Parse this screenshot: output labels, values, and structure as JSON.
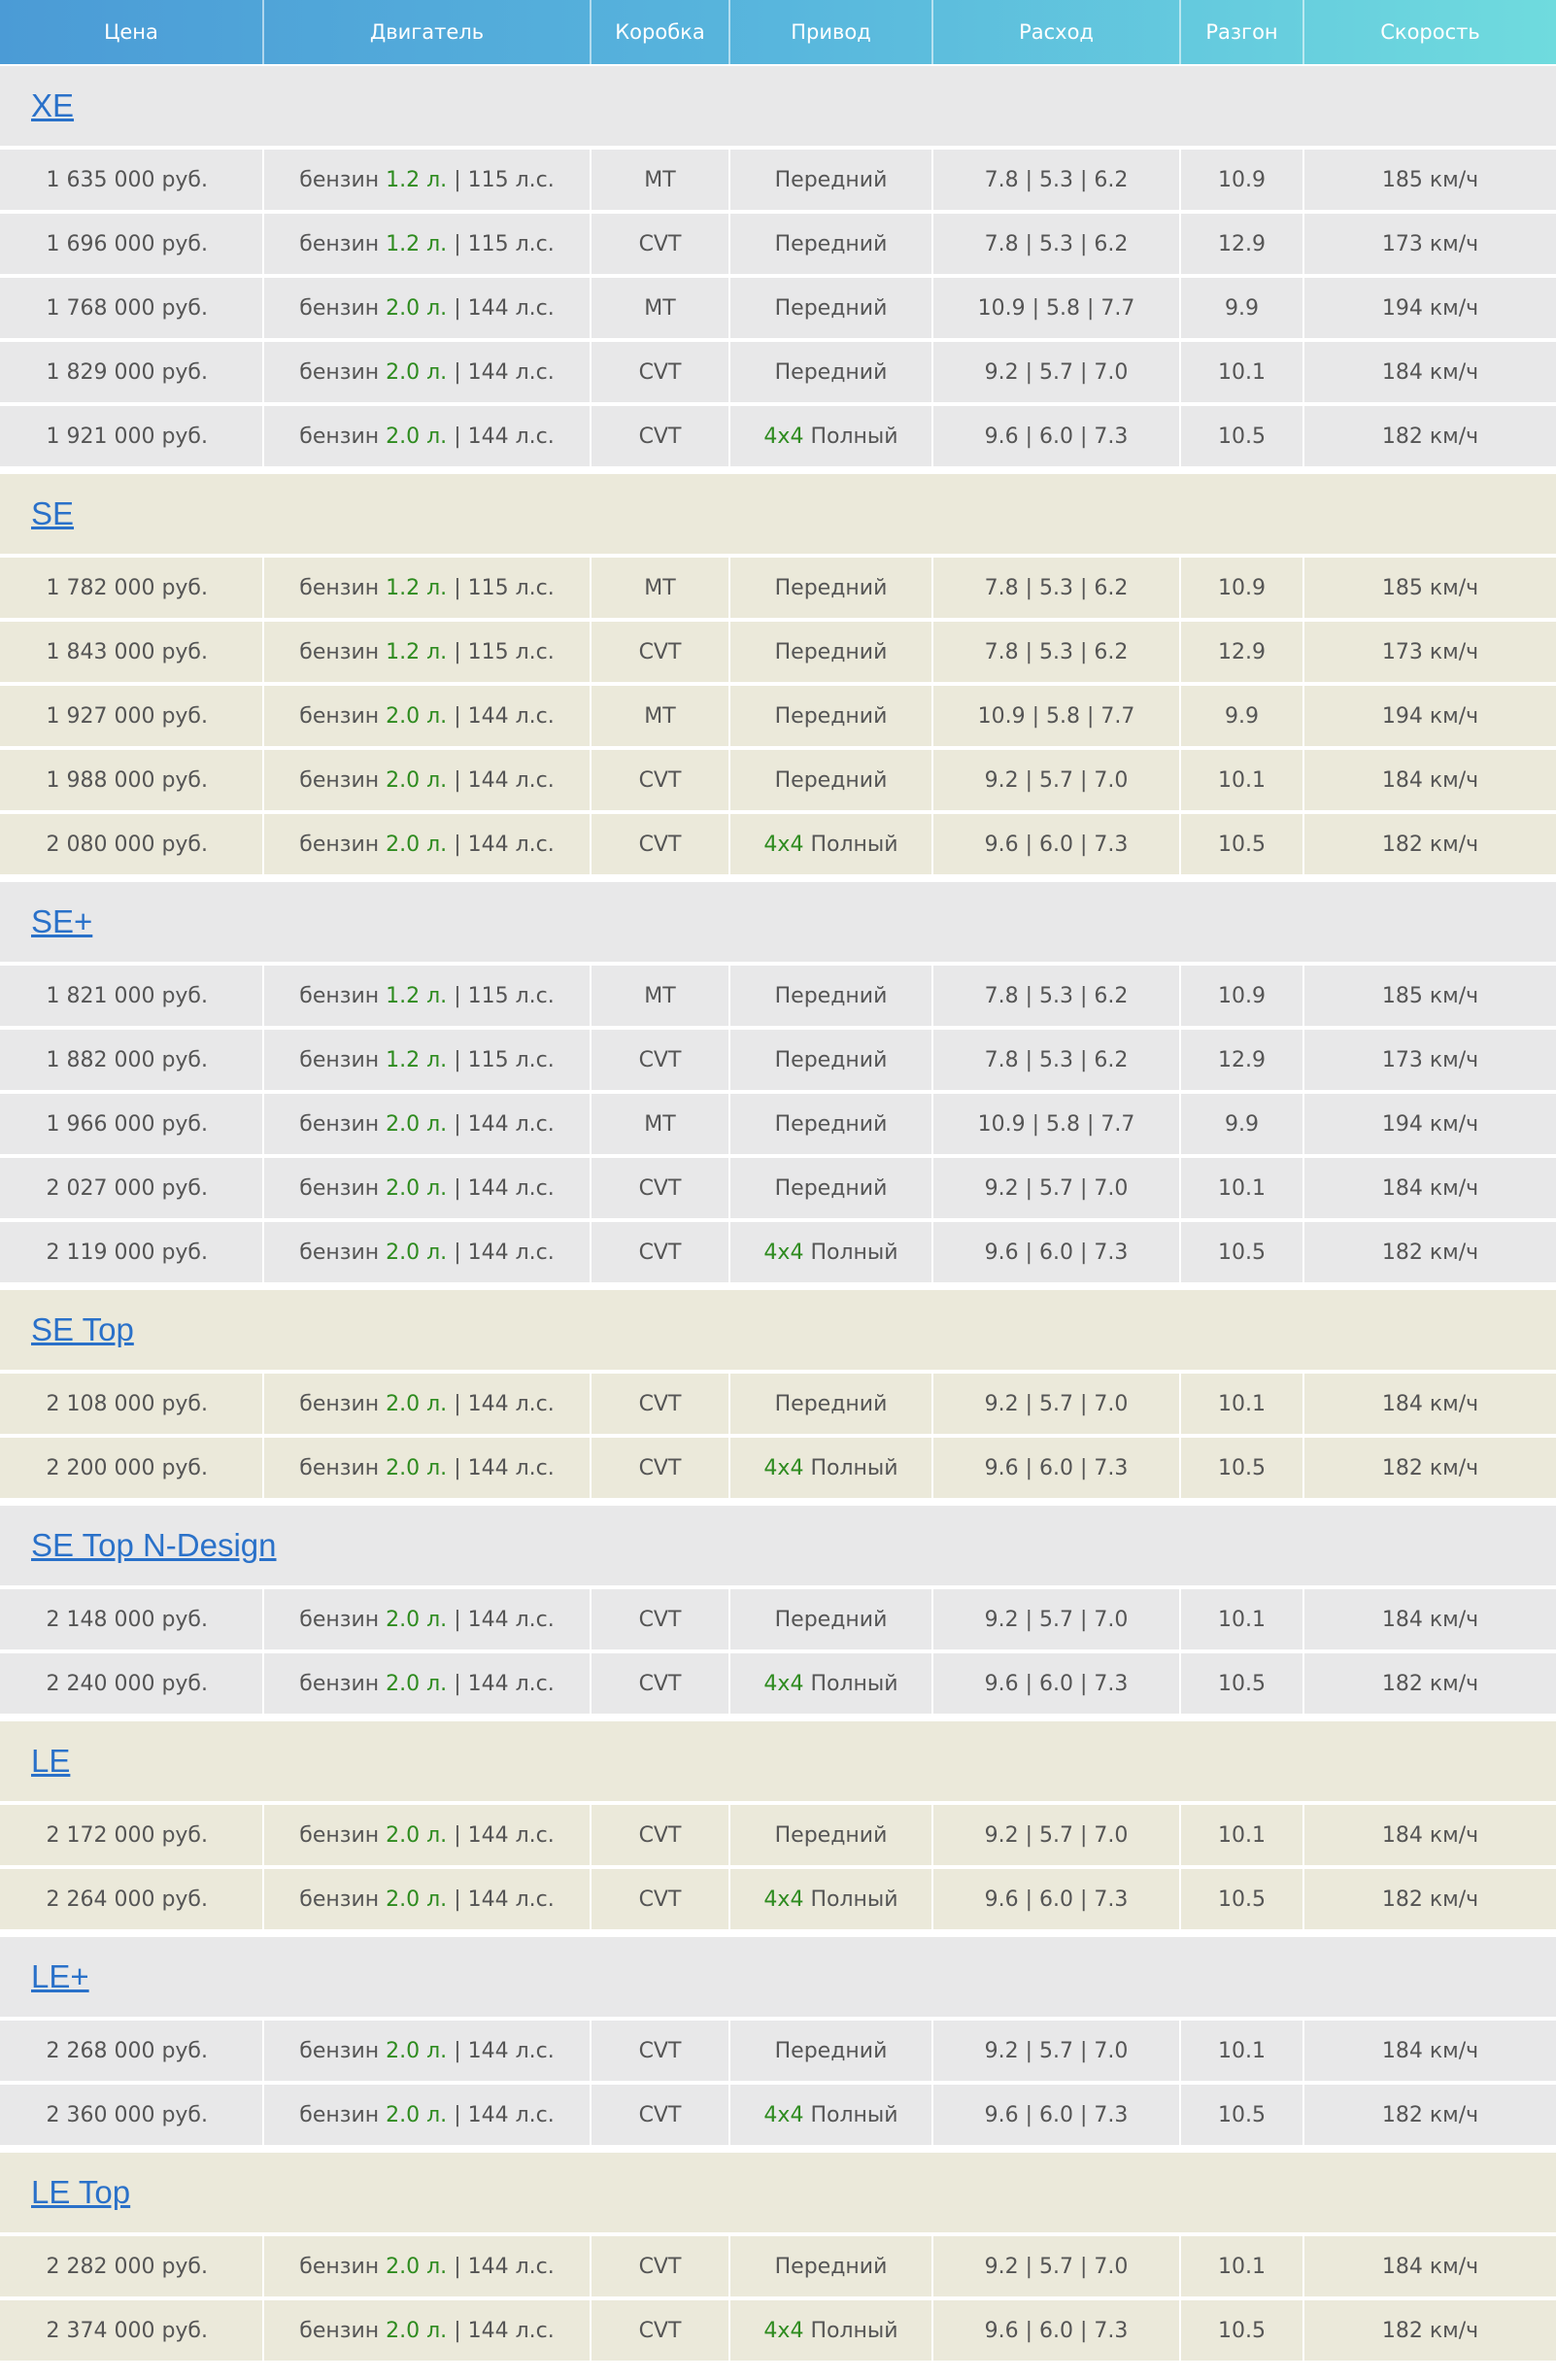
{
  "colors": {
    "header_gradient_start": "#4b9bd6",
    "header_gradient_end": "#6fdbde",
    "header_text": "#ffffff",
    "link": "#2a71c9",
    "green_accent": "#2e8b1f",
    "row_gray": "#e8e8e9",
    "row_beige": "#ebe9da",
    "cell_text": "#555555"
  },
  "header": {
    "price": "Цена",
    "engine": "Двигатель",
    "gearbox": "Коробка",
    "drive": "Привод",
    "consumption": "Расход",
    "acceleration": "Разгон",
    "speed": "Скорость"
  },
  "groups": [
    {
      "name": "XE",
      "rows": [
        {
          "price": "1 635 000 руб.",
          "fuel": "бензин",
          "volume": "1.2 л.",
          "power": "| 115 л.с.",
          "gearbox": "MT",
          "drive_tag": "",
          "drive": "Передний",
          "consumption": "7.8 | 5.3 | 6.2",
          "acceleration": "10.9",
          "speed": "185 км/ч"
        },
        {
          "price": "1 696 000 руб.",
          "fuel": "бензин",
          "volume": "1.2 л.",
          "power": "| 115 л.с.",
          "gearbox": "CVT",
          "drive_tag": "",
          "drive": "Передний",
          "consumption": "7.8 | 5.3 | 6.2",
          "acceleration": "12.9",
          "speed": "173 км/ч"
        },
        {
          "price": "1 768 000 руб.",
          "fuel": "бензин",
          "volume": "2.0 л.",
          "power": "| 144 л.с.",
          "gearbox": "MT",
          "drive_tag": "",
          "drive": "Передний",
          "consumption": "10.9 | 5.8 | 7.7",
          "acceleration": "9.9",
          "speed": "194 км/ч"
        },
        {
          "price": "1 829 000 руб.",
          "fuel": "бензин",
          "volume": "2.0 л.",
          "power": "| 144 л.с.",
          "gearbox": "CVT",
          "drive_tag": "",
          "drive": "Передний",
          "consumption": "9.2 | 5.7 | 7.0",
          "acceleration": "10.1",
          "speed": "184 км/ч"
        },
        {
          "price": "1 921 000 руб.",
          "fuel": "бензин",
          "volume": "2.0 л.",
          "power": "| 144 л.с.",
          "gearbox": "CVT",
          "drive_tag": "4x4",
          "drive": "Полный",
          "consumption": "9.6 | 6.0 | 7.3",
          "acceleration": "10.5",
          "speed": "182 км/ч"
        }
      ]
    },
    {
      "name": "SE",
      "rows": [
        {
          "price": "1 782 000 руб.",
          "fuel": "бензин",
          "volume": "1.2 л.",
          "power": "| 115 л.с.",
          "gearbox": "MT",
          "drive_tag": "",
          "drive": "Передний",
          "consumption": "7.8 | 5.3 | 6.2",
          "acceleration": "10.9",
          "speed": "185 км/ч"
        },
        {
          "price": "1 843 000 руб.",
          "fuel": "бензин",
          "volume": "1.2 л.",
          "power": "| 115 л.с.",
          "gearbox": "CVT",
          "drive_tag": "",
          "drive": "Передний",
          "consumption": "7.8 | 5.3 | 6.2",
          "acceleration": "12.9",
          "speed": "173 км/ч"
        },
        {
          "price": "1 927 000 руб.",
          "fuel": "бензин",
          "volume": "2.0 л.",
          "power": "| 144 л.с.",
          "gearbox": "MT",
          "drive_tag": "",
          "drive": "Передний",
          "consumption": "10.9 | 5.8 | 7.7",
          "acceleration": "9.9",
          "speed": "194 км/ч"
        },
        {
          "price": "1 988 000 руб.",
          "fuel": "бензин",
          "volume": "2.0 л.",
          "power": "| 144 л.с.",
          "gearbox": "CVT",
          "drive_tag": "",
          "drive": "Передний",
          "consumption": "9.2 | 5.7 | 7.0",
          "acceleration": "10.1",
          "speed": "184 км/ч"
        },
        {
          "price": "2 080 000 руб.",
          "fuel": "бензин",
          "volume": "2.0 л.",
          "power": "| 144 л.с.",
          "gearbox": "CVT",
          "drive_tag": "4x4",
          "drive": "Полный",
          "consumption": "9.6 | 6.0 | 7.3",
          "acceleration": "10.5",
          "speed": "182 км/ч"
        }
      ]
    },
    {
      "name": "SE+",
      "rows": [
        {
          "price": "1 821 000 руб.",
          "fuel": "бензин",
          "volume": "1.2 л.",
          "power": "| 115 л.с.",
          "gearbox": "MT",
          "drive_tag": "",
          "drive": "Передний",
          "consumption": "7.8 | 5.3 | 6.2",
          "acceleration": "10.9",
          "speed": "185 км/ч"
        },
        {
          "price": "1 882 000 руб.",
          "fuel": "бензин",
          "volume": "1.2 л.",
          "power": "| 115 л.с.",
          "gearbox": "CVT",
          "drive_tag": "",
          "drive": "Передний",
          "consumption": "7.8 | 5.3 | 6.2",
          "acceleration": "12.9",
          "speed": "173 км/ч"
        },
        {
          "price": "1 966 000 руб.",
          "fuel": "бензин",
          "volume": "2.0 л.",
          "power": "| 144 л.с.",
          "gearbox": "MT",
          "drive_tag": "",
          "drive": "Передний",
          "consumption": "10.9 | 5.8 | 7.7",
          "acceleration": "9.9",
          "speed": "194 км/ч"
        },
        {
          "price": "2 027 000 руб.",
          "fuel": "бензин",
          "volume": "2.0 л.",
          "power": "| 144 л.с.",
          "gearbox": "CVT",
          "drive_tag": "",
          "drive": "Передний",
          "consumption": "9.2 | 5.7 | 7.0",
          "acceleration": "10.1",
          "speed": "184 км/ч"
        },
        {
          "price": "2 119 000 руб.",
          "fuel": "бензин",
          "volume": "2.0 л.",
          "power": "| 144 л.с.",
          "gearbox": "CVT",
          "drive_tag": "4x4",
          "drive": "Полный",
          "consumption": "9.6 | 6.0 | 7.3",
          "acceleration": "10.5",
          "speed": "182 км/ч"
        }
      ]
    },
    {
      "name": "SE Top",
      "rows": [
        {
          "price": "2 108 000 руб.",
          "fuel": "бензин",
          "volume": "2.0 л.",
          "power": "| 144 л.с.",
          "gearbox": "CVT",
          "drive_tag": "",
          "drive": "Передний",
          "consumption": "9.2 | 5.7 | 7.0",
          "acceleration": "10.1",
          "speed": "184 км/ч"
        },
        {
          "price": "2 200 000 руб.",
          "fuel": "бензин",
          "volume": "2.0 л.",
          "power": "| 144 л.с.",
          "gearbox": "CVT",
          "drive_tag": "4x4",
          "drive": "Полный",
          "consumption": "9.6 | 6.0 | 7.3",
          "acceleration": "10.5",
          "speed": "182 км/ч"
        }
      ]
    },
    {
      "name": "SE Top N-Design",
      "rows": [
        {
          "price": "2 148 000 руб.",
          "fuel": "бензин",
          "volume": "2.0 л.",
          "power": "| 144 л.с.",
          "gearbox": "CVT",
          "drive_tag": "",
          "drive": "Передний",
          "consumption": "9.2 | 5.7 | 7.0",
          "acceleration": "10.1",
          "speed": "184 км/ч"
        },
        {
          "price": "2 240 000 руб.",
          "fuel": "бензин",
          "volume": "2.0 л.",
          "power": "| 144 л.с.",
          "gearbox": "CVT",
          "drive_tag": "4x4",
          "drive": "Полный",
          "consumption": "9.6 | 6.0 | 7.3",
          "acceleration": "10.5",
          "speed": "182 км/ч"
        }
      ]
    },
    {
      "name": "LE",
      "rows": [
        {
          "price": "2 172 000 руб.",
          "fuel": "бензин",
          "volume": "2.0 л.",
          "power": "| 144 л.с.",
          "gearbox": "CVT",
          "drive_tag": "",
          "drive": "Передний",
          "consumption": "9.2 | 5.7 | 7.0",
          "acceleration": "10.1",
          "speed": "184 км/ч"
        },
        {
          "price": "2 264 000 руб.",
          "fuel": "бензин",
          "volume": "2.0 л.",
          "power": "| 144 л.с.",
          "gearbox": "CVT",
          "drive_tag": "4x4",
          "drive": "Полный",
          "consumption": "9.6 | 6.0 | 7.3",
          "acceleration": "10.5",
          "speed": "182 км/ч"
        }
      ]
    },
    {
      "name": "LE+",
      "rows": [
        {
          "price": "2 268 000 руб.",
          "fuel": "бензин",
          "volume": "2.0 л.",
          "power": "| 144 л.с.",
          "gearbox": "CVT",
          "drive_tag": "",
          "drive": "Передний",
          "consumption": "9.2 | 5.7 | 7.0",
          "acceleration": "10.1",
          "speed": "184 км/ч"
        },
        {
          "price": "2 360 000 руб.",
          "fuel": "бензин",
          "volume": "2.0 л.",
          "power": "| 144 л.с.",
          "gearbox": "CVT",
          "drive_tag": "4x4",
          "drive": "Полный",
          "consumption": "9.6 | 6.0 | 7.3",
          "acceleration": "10.5",
          "speed": "182 км/ч"
        }
      ]
    },
    {
      "name": "LE Top",
      "rows": [
        {
          "price": "2 282 000 руб.",
          "fuel": "бензин",
          "volume": "2.0 л.",
          "power": "| 144 л.с.",
          "gearbox": "CVT",
          "drive_tag": "",
          "drive": "Передний",
          "consumption": "9.2 | 5.7 | 7.0",
          "acceleration": "10.1",
          "speed": "184 км/ч"
        },
        {
          "price": "2 374 000 руб.",
          "fuel": "бензин",
          "volume": "2.0 л.",
          "power": "| 144 л.с.",
          "gearbox": "CVT",
          "drive_tag": "4x4",
          "drive": "Полный",
          "consumption": "9.6 | 6.0 | 7.3",
          "acceleration": "10.5",
          "speed": "182 км/ч"
        }
      ]
    }
  ]
}
